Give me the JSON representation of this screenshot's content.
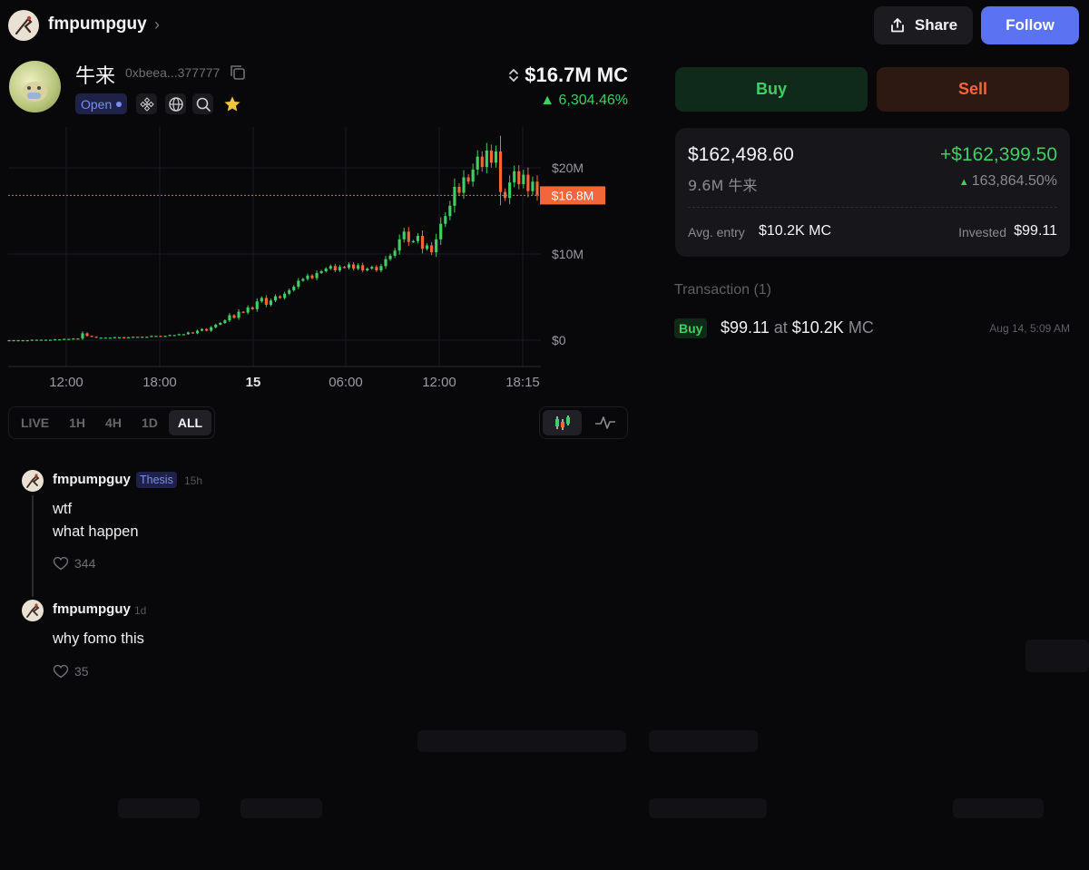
{
  "header": {
    "username": "fmpumpguy",
    "share_label": "Share",
    "follow_label": "Follow"
  },
  "token": {
    "name": "牛来",
    "address": "0xbeea...377777",
    "status": "Open",
    "market_cap": "$16.7M MC",
    "change": "6,304.46%",
    "icons": [
      "copy-icon",
      "bnb-icon",
      "globe-icon",
      "search-icon",
      "star-icon"
    ]
  },
  "chart": {
    "timeframes": [
      "LIVE",
      "1H",
      "4H",
      "1D",
      "ALL"
    ],
    "active_timeframe": "ALL",
    "chart_types": [
      "candlestick-icon",
      "line-chart-icon"
    ],
    "colors": {
      "up": "#3fcf62",
      "down": "#f3653b",
      "current": "#f3653b"
    }
  },
  "chart_data": {
    "type": "candlestick",
    "y_tick_labels": [
      "$20M",
      "$10M",
      "$0"
    ],
    "y_ticks": [
      20,
      10,
      0
    ],
    "y_unit": "$M",
    "ylim": [
      0,
      24
    ],
    "current_price_label": "$16.8M",
    "current_value": 16.8,
    "x_tick_labels": [
      "12:00",
      "18:00",
      "15",
      "06:00",
      "12:00",
      "18:15"
    ],
    "grid": true,
    "close_values": [
      0.0,
      0.0,
      0.0,
      0.0,
      0.0,
      0.05,
      0.05,
      0.05,
      0.05,
      0.05,
      0.1,
      0.1,
      0.15,
      0.15,
      0.2,
      0.2,
      0.8,
      0.5,
      0.4,
      0.3,
      0.3,
      0.3,
      0.3,
      0.35,
      0.35,
      0.3,
      0.35,
      0.4,
      0.4,
      0.4,
      0.4,
      0.5,
      0.5,
      0.45,
      0.5,
      0.6,
      0.6,
      0.7,
      0.7,
      0.9,
      0.8,
      1.1,
      1.3,
      1.1,
      1.5,
      1.8,
      2.0,
      2.3,
      2.9,
      2.6,
      3.3,
      3.2,
      3.8,
      3.6,
      4.5,
      4.9,
      4.1,
      4.6,
      5.1,
      4.9,
      5.4,
      5.8,
      6.2,
      6.9,
      7.1,
      7.5,
      7.2,
      7.8,
      8.0,
      8.3,
      8.6,
      8.1,
      8.5,
      8.4,
      8.8,
      8.3,
      8.7,
      8.1,
      8.3,
      8.5,
      8.1,
      8.6,
      9.4,
      9.8,
      10.4,
      11.7,
      12.6,
      11.4,
      11.5,
      12.1,
      10.6,
      11.0,
      10.2,
      11.7,
      13.5,
      14.4,
      15.6,
      17.8,
      17.1,
      18.9,
      18.4,
      19.8,
      21.3,
      20.1,
      22.0,
      20.6,
      21.9,
      17.2,
      16.5,
      18.3,
      19.6,
      18.1,
      19.2,
      17.3,
      18.4,
      16.8
    ],
    "series": [
      {
        "values_in": "$M"
      }
    ]
  },
  "comments": [
    {
      "user": "fmpumpguy",
      "badge": "Thesis",
      "time": "15h",
      "lines": [
        "wtf",
        "what happen"
      ],
      "likes": "344"
    },
    {
      "user": "fmpumpguy",
      "badge": "",
      "time": "1d",
      "lines": [
        "why fomo this"
      ],
      "likes": "35"
    }
  ],
  "trade": {
    "buy_label": "Buy",
    "sell_label": "Sell"
  },
  "position": {
    "value": "$162,498.60",
    "pnl": "+$162,399.50",
    "amount": "9.6M 牛来",
    "pnl_pct": "163,864.50%",
    "avg_entry_label": "Avg. entry",
    "avg_entry_value": "$10.2K MC",
    "invested_label": "Invested",
    "invested_value": "$99.11"
  },
  "transactions": {
    "title": "Transaction (1)",
    "items": [
      {
        "side": "Buy",
        "amount": "$99.11",
        "at": "at",
        "mc": "$10.2K",
        "mc_suffix": "MC",
        "time": "Aug 14, 5:09 AM"
      }
    ]
  }
}
